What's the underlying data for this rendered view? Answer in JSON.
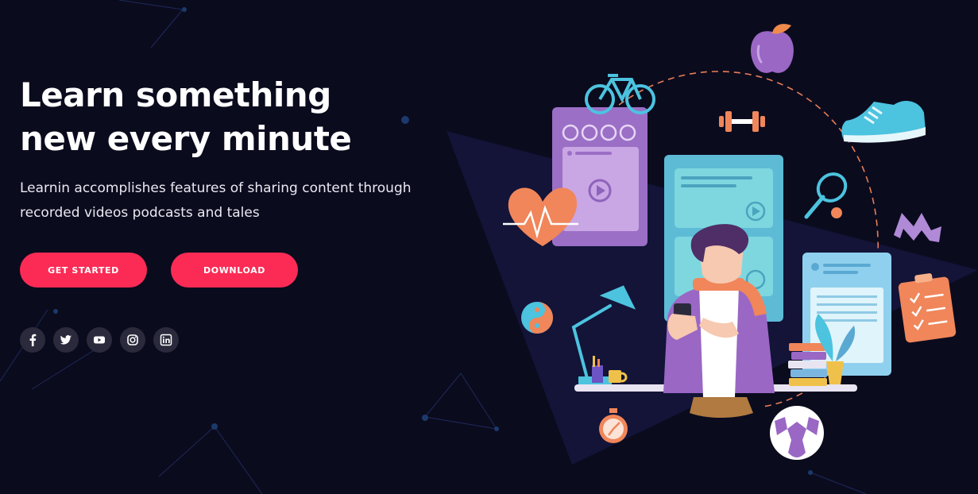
{
  "hero": {
    "headline": "Learn something new every minute",
    "description": "Learnin accomplishes features of sharing content through recorded videos podcasts and tales",
    "primary_button": "GET STARTED",
    "secondary_button": "DOWNLOAD"
  },
  "social": {
    "items": [
      {
        "name": "facebook-icon",
        "glyph": "f"
      },
      {
        "name": "twitter-icon",
        "glyph": ""
      },
      {
        "name": "youtube-icon",
        "glyph": ""
      },
      {
        "name": "instagram-icon",
        "glyph": ""
      },
      {
        "name": "linkedin-icon",
        "glyph": ""
      }
    ]
  },
  "colors": {
    "background": "#0b0b1e",
    "accent": "#fb2b55",
    "social_bg": "#2b2a3d"
  }
}
